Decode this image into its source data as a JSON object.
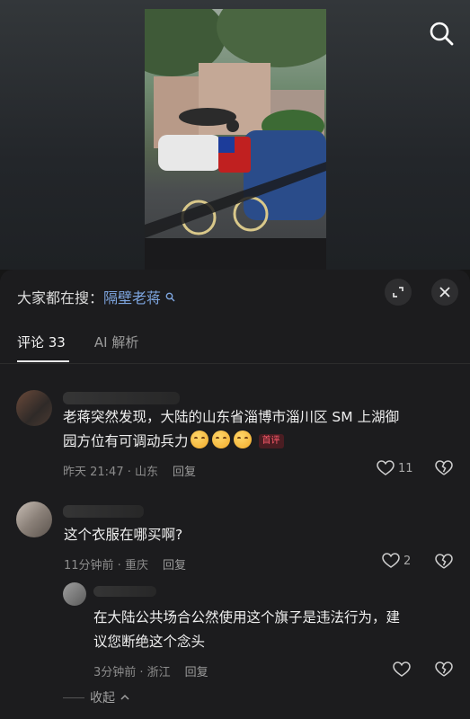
{
  "header": {
    "search_prefix": "大家都在搜：",
    "search_term": "隔壁老蒋"
  },
  "tabs": [
    {
      "label": "评论 33"
    },
    {
      "label": "AI 解析"
    }
  ],
  "comments": [
    {
      "text_line1": "老蒋突然发现，大陆的山东省淄博市淄川区 SM 上湖御",
      "text_line2": "园方位有可调动兵力",
      "badge": "首评",
      "time_location": "昨天 21:47 · 山东",
      "reply_label": "回复",
      "likes": "11"
    },
    {
      "text": "这个衣服在哪买啊?",
      "time_location": "11分钟前 · 重庆",
      "reply_label": "回复",
      "likes": "2"
    }
  ],
  "reply": {
    "text_line1": "在大陆公共场合公然使用这个旗子是违法行为，建",
    "text_line2": "议您断绝这个念头",
    "time_location": "3分钟前 · 浙江",
    "reply_label": "回复"
  },
  "collapse_label": "收起"
}
